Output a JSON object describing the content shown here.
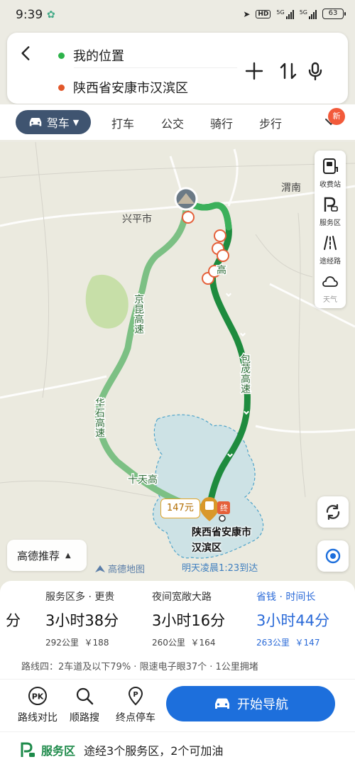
{
  "status_bar": {
    "time": "9:39",
    "net_a": "5G",
    "net_b": "5G",
    "hd": "HD",
    "battery": "63"
  },
  "route_card": {
    "origin": "我的位置",
    "destination": "陕西省安康市汉滨区",
    "origin_color": "#2db34a",
    "destination_color": "#e2572a"
  },
  "modes": {
    "active": "驾车",
    "tabs": [
      "打车",
      "公交",
      "骑行",
      "步行"
    ],
    "badge": "新"
  },
  "tools": [
    {
      "label": "收费站",
      "icon": "toll-station-icon"
    },
    {
      "label": "服务区",
      "icon": "service-area-icon"
    },
    {
      "label": "途经路",
      "icon": "via-road-icon"
    },
    {
      "label": "天气",
      "icon": "weather-icon"
    }
  ],
  "map": {
    "places": {
      "weinan": "渭南",
      "xingping": "兴平市"
    },
    "roads": {
      "jingkun": "京昆高速",
      "huashi": "华石高速",
      "shitian": "十天高",
      "baomao": "包茂高速",
      "gao": "高"
    },
    "toll_price": "147元",
    "destination_label_1": "陕西省安康市",
    "destination_label_2": "汉滨区",
    "end_marker": "终",
    "route_color": "#1e8b3e",
    "alt_route_color": "#7cc084"
  },
  "recommend": {
    "label": "高德推荐"
  },
  "brand": "高德地图",
  "arrival": "明天凌晨1:23到达",
  "routes": {
    "partial_duration": "分",
    "options": [
      {
        "tag": "服务区多 · 更贵",
        "duration": "3小时38分",
        "distance": "292公里",
        "cost": "￥188",
        "selected": false
      },
      {
        "tag": "夜间宽敞大路",
        "duration": "3小时16分",
        "distance": "260公里",
        "cost": "￥164",
        "selected": false
      },
      {
        "tag": "省钱 · 时间长",
        "duration": "3小时44分",
        "distance": "263公里",
        "cost": "￥147",
        "selected": true
      }
    ],
    "info": "路线四：2车道及以下79% · 限速电子眼37个 · 1公里拥堵"
  },
  "actions": {
    "compare": "路线对比",
    "search_along": "顺路搜",
    "parking": "终点停车",
    "start": "开始导航"
  },
  "service": {
    "title": "服务区",
    "desc": "途经3个服务区，2个可加油"
  }
}
